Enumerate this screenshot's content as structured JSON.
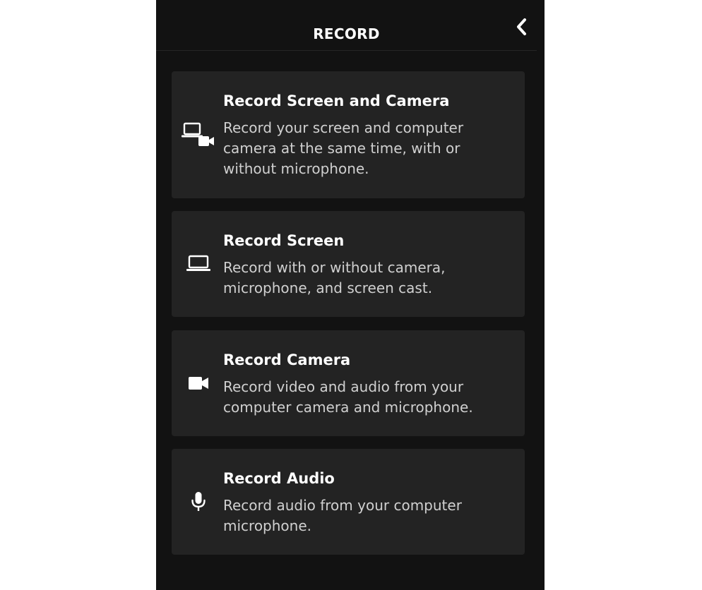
{
  "header": {
    "title": "RECORD",
    "back_icon": "chevron-left-icon"
  },
  "options": [
    {
      "icon": "screen-and-camera-icon",
      "title": "Record Screen and Camera",
      "description": "Record your screen and computer camera at the same time, with or without microphone."
    },
    {
      "icon": "laptop-icon",
      "title": "Record Screen",
      "description": "Record with or without camera, microphone, and screen cast."
    },
    {
      "icon": "video-camera-icon",
      "title": "Record Camera",
      "description": "Record video and audio from your computer camera and microphone."
    },
    {
      "icon": "microphone-icon",
      "title": "Record Audio",
      "description": "Record audio from your computer microphone."
    }
  ],
  "colors": {
    "panel_background": "#121212",
    "card_background": "#232323",
    "title_text": "#ffffff",
    "description_text": "#d0d0d0"
  }
}
